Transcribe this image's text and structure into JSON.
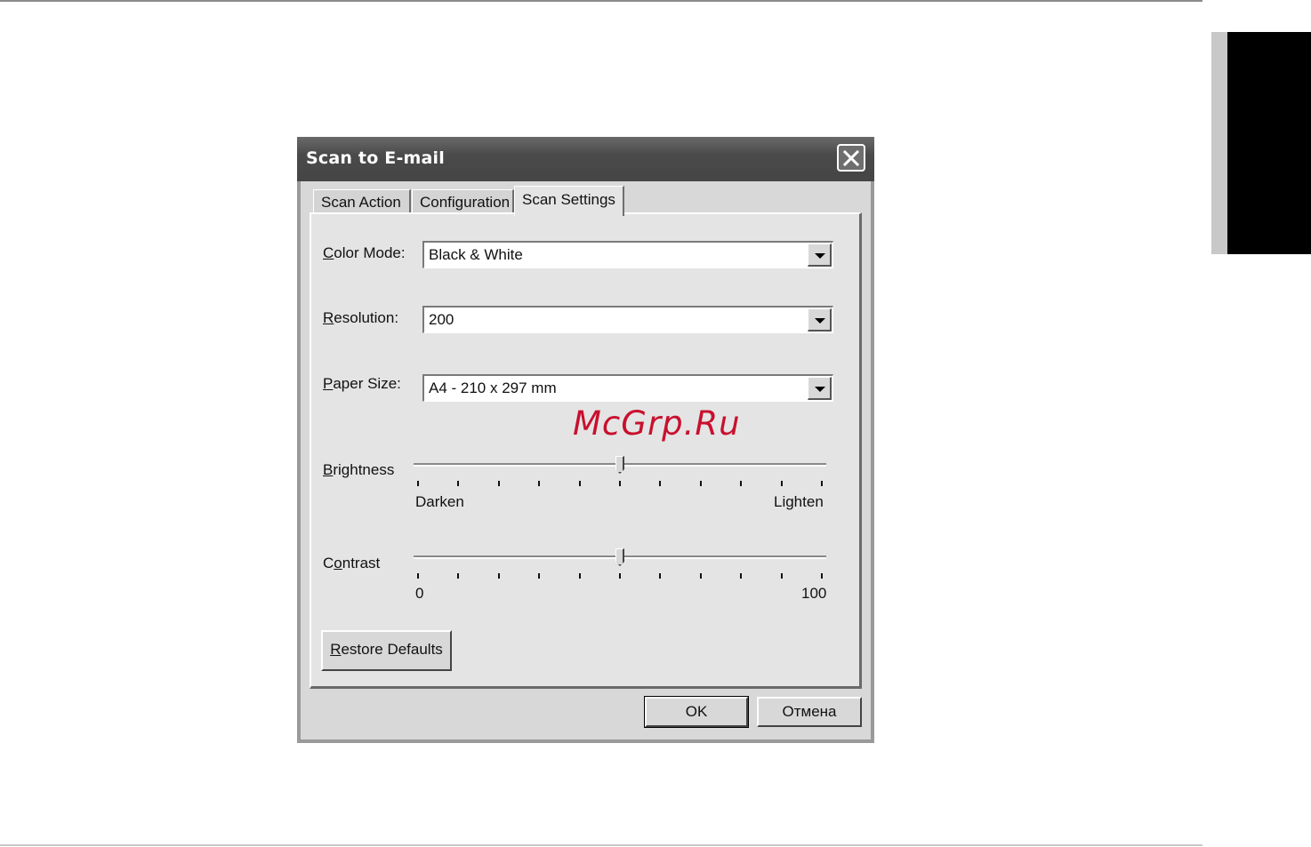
{
  "window": {
    "title": "Scan to E-mail",
    "close_icon": "close-icon"
  },
  "tabs": [
    {
      "label": "Scan Action",
      "active": false
    },
    {
      "label": "Configuration",
      "active": false
    },
    {
      "label": "Scan Settings",
      "active": true
    }
  ],
  "fields": {
    "color_mode": {
      "label_key": "C",
      "label_rest": "olor Mode:",
      "value": "Black & White"
    },
    "resolution": {
      "label_key": "R",
      "label_rest": "esolution:",
      "value": "200"
    },
    "paper_size": {
      "label_key": "P",
      "label_rest": "aper Size:",
      "value": "A4 - 210 x 297 mm"
    }
  },
  "sliders": {
    "brightness": {
      "label_key": "B",
      "label_rest": "rightness",
      "min_label": "Darken",
      "max_label": "Lighten",
      "level": 0.5
    },
    "contrast": {
      "label_pre": "C",
      "label_key": "o",
      "label_rest": "ntrast",
      "min_label": "0",
      "max_label": "100",
      "level": 0.5
    }
  },
  "buttons": {
    "restore_key": "R",
    "restore_rest": "estore Defaults",
    "ok": "OK",
    "cancel": "Отмена"
  },
  "watermark": "McGrp.Ru",
  "colors": {
    "watermark": "#c8102e",
    "titlebar": "#4a4a4a",
    "side_tab": "#000000"
  }
}
